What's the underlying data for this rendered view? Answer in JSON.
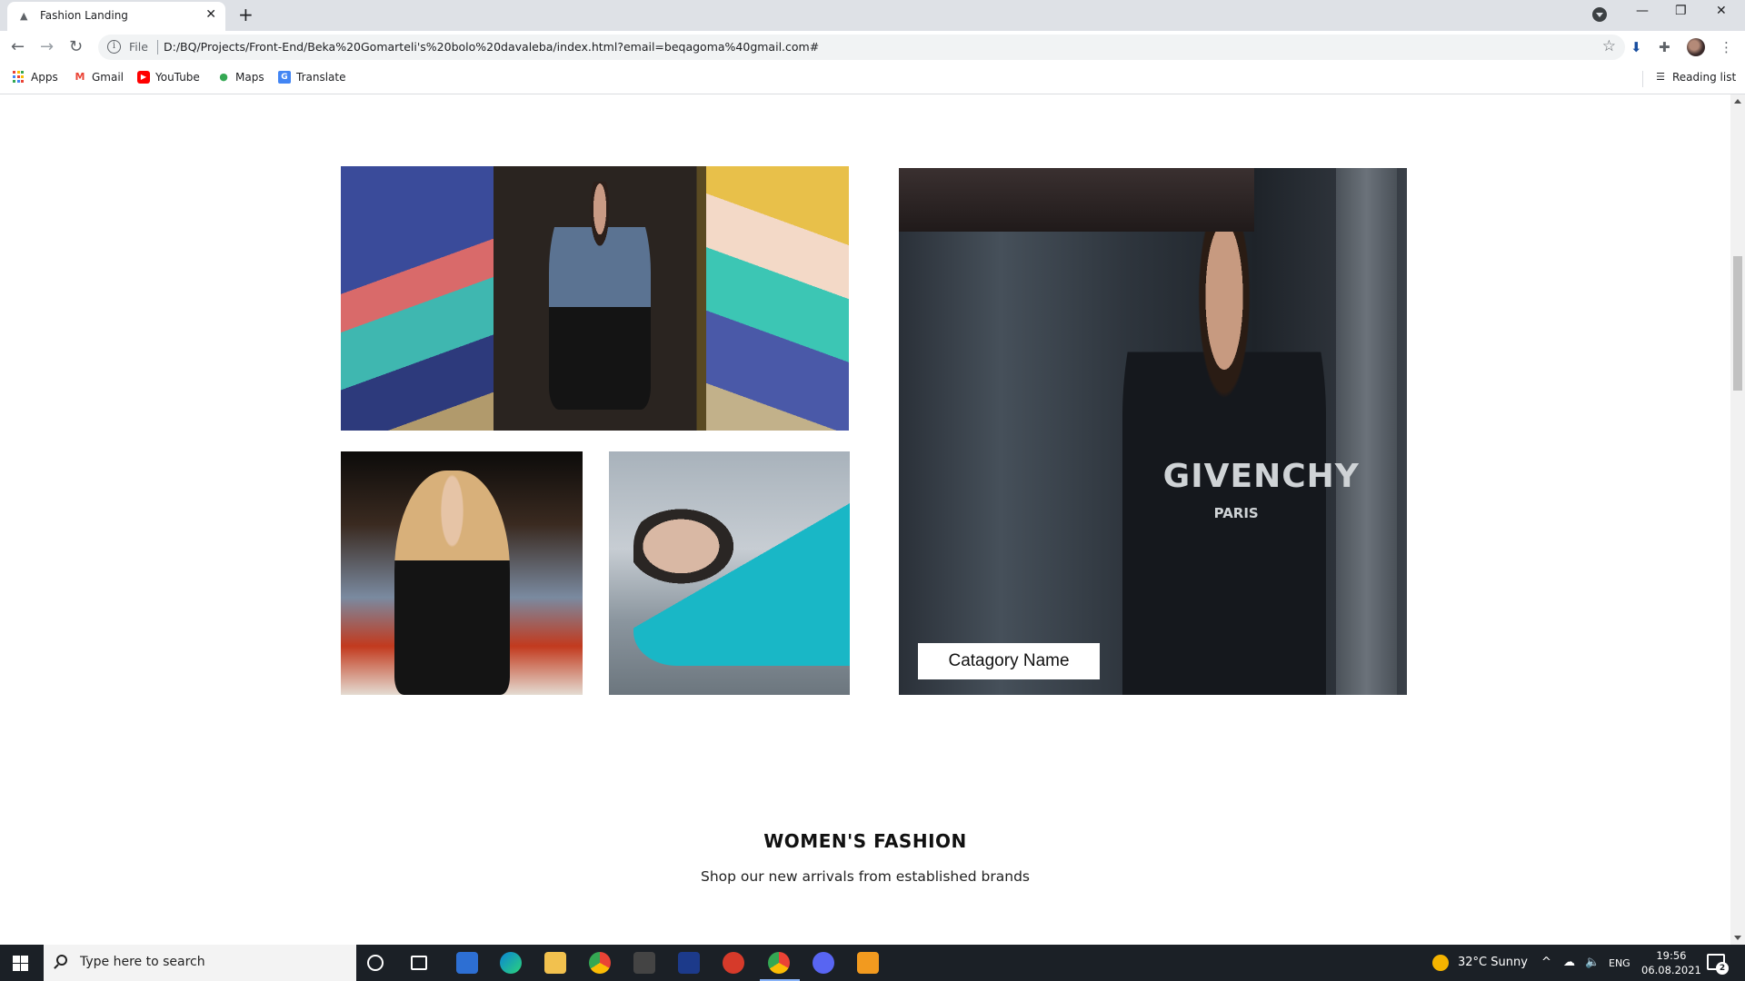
{
  "browser": {
    "tab_title": "Fashion Landing",
    "tab_close": "✕",
    "new_tab": "+",
    "address_scheme": "File",
    "address_url": "D:/BQ/Projects/Front-End/Beka%20Gomarteli's%20bolo%20davaleba/index.html?email=beqagoma%40gmail.com#",
    "bookmarks": [
      {
        "label": "Apps",
        "icon": "apps-grid-icon"
      },
      {
        "label": "Gmail",
        "icon": "gmail-icon"
      },
      {
        "label": "YouTube",
        "icon": "youtube-icon"
      },
      {
        "label": "Maps",
        "icon": "maps-pin-icon"
      },
      {
        "label": "Translate",
        "icon": "translate-icon"
      }
    ],
    "reading_list": "Reading list"
  },
  "page": {
    "category_label": "Catagory Name",
    "photo_4_brand": "GIVENCHY",
    "photo_4_brand_sub": "PARIS",
    "section_title": "WOMEN'S FASHION",
    "section_subtitle": "Shop our new arrivals from established brands"
  },
  "taskbar": {
    "search_placeholder": "Type here to search",
    "weather": "32°C  Sunny",
    "language": "ENG",
    "time": "19:56",
    "date": "06.08.2021",
    "notifications_count": "2"
  },
  "colors": {
    "tabbar": "#dee1e6",
    "taskbar": "#1b2026",
    "accent_teal": "#19b7c6"
  }
}
